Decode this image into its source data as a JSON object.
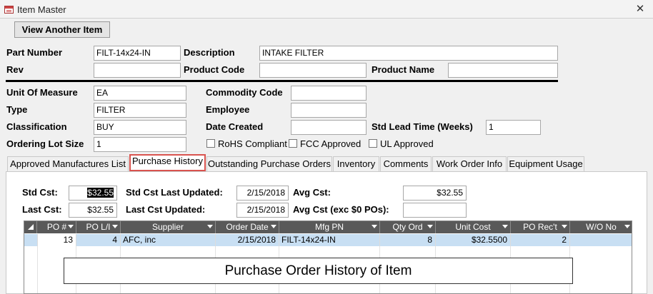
{
  "window": {
    "title": "Item Master",
    "close_icon": "close-icon",
    "title_icon": "form-icon"
  },
  "toolbar": {
    "view_another_label": "View Another Item"
  },
  "item": {
    "part_number_label": "Part Number",
    "part_number": "FILT-14x24-IN",
    "description_label": "Description",
    "description": "INTAKE FILTER",
    "rev_label": "Rev",
    "rev": "",
    "product_code_label": "Product Code",
    "product_code": "",
    "product_name_label": "Product Name",
    "product_name": "",
    "uom_label": "Unit Of Measure",
    "uom": "EA",
    "commodity_code_label": "Commodity Code",
    "commodity_code": "",
    "type_label": "Type",
    "type": "FILTER",
    "employee_label": "Employee",
    "employee": "",
    "classification_label": "Classification",
    "classification": "BUY",
    "date_created_label": "Date Created",
    "date_created": "",
    "std_lead_time_label": "Std Lead Time (Weeks)",
    "std_lead_time": "1",
    "ordering_lot_size_label": "Ordering Lot Size",
    "ordering_lot_size": "1",
    "rohs_label": "RoHS Compliant",
    "rohs_checked": false,
    "fcc_label": "FCC Approved",
    "fcc_checked": false,
    "ul_label": "UL Approved",
    "ul_checked": false
  },
  "tabs": [
    {
      "label": "Approved Manufactures List",
      "active": false
    },
    {
      "label": "Purchase History",
      "active": true
    },
    {
      "label": "Outstanding Purchase Orders",
      "active": false
    },
    {
      "label": "Inventory",
      "active": false
    },
    {
      "label": "Comments",
      "active": false
    },
    {
      "label": "Work Order Info",
      "active": false
    },
    {
      "label": "Equipment Usage",
      "active": false
    }
  ],
  "purchase": {
    "std_cost_label": "Std Cst:",
    "std_cost": "$32.55",
    "std_cost_updated_label": "Std Cst Last Updated:",
    "std_cost_updated": "2/15/2018",
    "avg_cost_label": "Avg Cst:",
    "avg_cost": "$32.55",
    "last_cost_label": "Last Cst:",
    "last_cost": "$32.55",
    "last_cost_updated_label": "Last Cst Updated:",
    "last_cost_updated": "2/15/2018",
    "avg_cost_excl_label": "Avg Cst (exc $0 POs):",
    "avg_cost_excl": ""
  },
  "grid": {
    "columns": [
      "PO #",
      "PO L/I",
      "Supplier",
      "Order Date",
      "Mfg PN",
      "Qty Ord",
      "Unit Cost",
      "PO Rec't",
      "W/O No"
    ],
    "rows": [
      {
        "po": "13",
        "po_li": "4",
        "supplier": "AFC, inc",
        "order_date": "2/15/2018",
        "mfg_pn": "FILT-14x24-IN",
        "qty_ord": "8",
        "unit_cost": "$32.5500",
        "po_rect": "2",
        "wo_no": ""
      }
    ]
  },
  "caption": "Purchase Order History of Item",
  "colors": {
    "active_tab_border": "#d9534f",
    "grid_header": "#595959",
    "selected_row": "#c8dff3"
  }
}
